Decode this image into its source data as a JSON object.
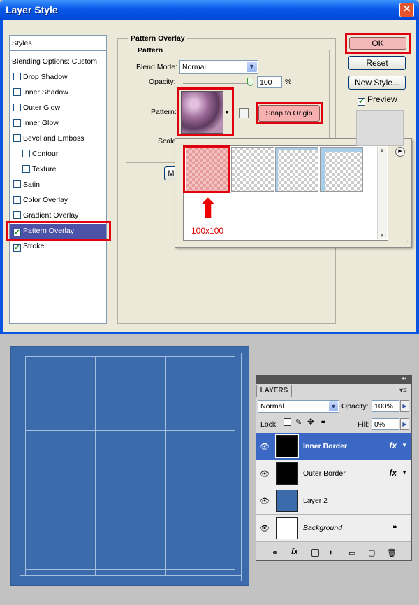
{
  "dialog": {
    "title": "Layer Style",
    "close_glyph": "✕",
    "styles_list": {
      "header": "Styles",
      "blending": "Blending Options: Custom",
      "items": [
        {
          "label": "Drop Shadow",
          "checked": false,
          "indent": false
        },
        {
          "label": "Inner Shadow",
          "checked": false,
          "indent": false
        },
        {
          "label": "Outer Glow",
          "checked": false,
          "indent": false
        },
        {
          "label": "Inner Glow",
          "checked": false,
          "indent": false
        },
        {
          "label": "Bevel and Emboss",
          "checked": false,
          "indent": false
        },
        {
          "label": "Contour",
          "checked": false,
          "indent": true
        },
        {
          "label": "Texture",
          "checked": false,
          "indent": true
        },
        {
          "label": "Satin",
          "checked": false,
          "indent": false
        },
        {
          "label": "Color Overlay",
          "checked": false,
          "indent": false
        },
        {
          "label": "Gradient Overlay",
          "checked": false,
          "indent": false
        },
        {
          "label": "Pattern Overlay",
          "checked": true,
          "indent": false,
          "active": true
        },
        {
          "label": "Stroke",
          "checked": true,
          "indent": false
        }
      ]
    },
    "panel": {
      "group_title": "Pattern Overlay",
      "subgroup_title": "Pattern",
      "blend_mode_label": "Blend Mode:",
      "blend_mode_value": "Normal",
      "opacity_label": "Opacity:",
      "opacity_value": "100",
      "opacity_unit": "%",
      "pattern_label": "Pattern:",
      "snap_button": "Snap to Origin",
      "scale_label": "Scale:",
      "make_default_partial": "M"
    },
    "picker": {
      "size_label": "100x100",
      "arrow_glyph": "⬆",
      "menu_glyph": "▶"
    },
    "buttons": {
      "ok": "OK",
      "reset": "Reset",
      "new_style": "New Style...",
      "preview": "Preview",
      "preview_checked": true
    }
  },
  "layers_panel": {
    "tab": "LAYERS",
    "blend_mode": "Normal",
    "opacity_label": "Opacity:",
    "opacity_value": "100%",
    "lock_label": "Lock:",
    "fill_label": "Fill:",
    "fill_value": "0%",
    "layers": [
      {
        "name": "Inner Border",
        "selected": true,
        "thumb": "#000000",
        "fx": true
      },
      {
        "name": "Outer Border",
        "selected": false,
        "thumb": "#000000",
        "fx": true
      },
      {
        "name": "Layer 2",
        "selected": false,
        "thumb": "#3c6bac",
        "fx": false
      },
      {
        "name": "Background",
        "selected": false,
        "thumb": "#ffffff",
        "fx": false,
        "locked": true
      }
    ]
  },
  "colors": {
    "highlight": "#e0000e",
    "canvas_blue": "#3c6bac",
    "selection_blue": "#3a68c4"
  }
}
